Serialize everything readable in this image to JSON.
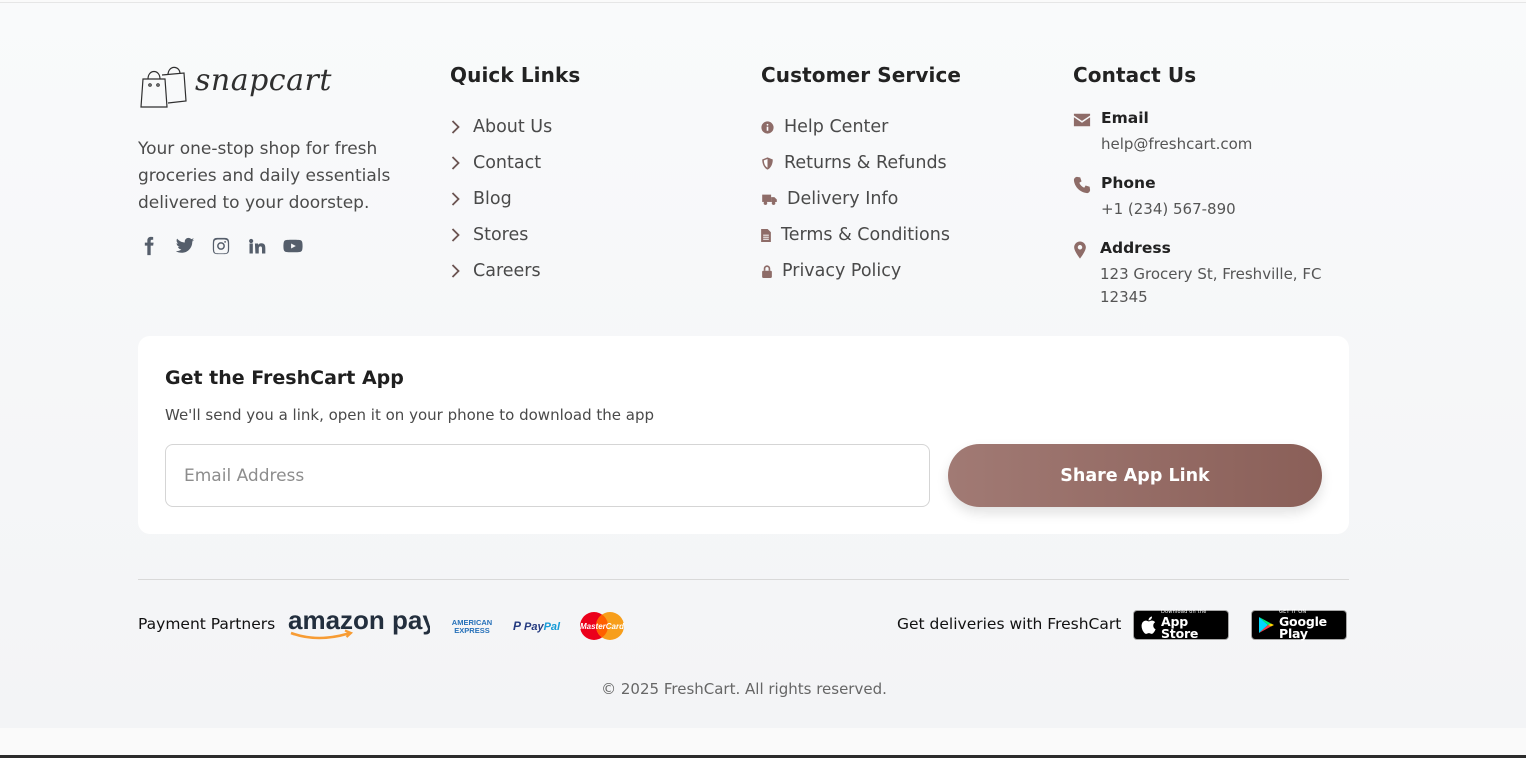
{
  "brand": {
    "logo_text": "snapcart",
    "tagline": "Your one-stop shop for fresh groceries and daily essentials delivered to your doorstep.",
    "socials": [
      "facebook-icon",
      "twitter-icon",
      "instagram-icon",
      "linkedin-icon",
      "youtube-icon"
    ]
  },
  "quick_links": {
    "title": "Quick Links",
    "items": [
      {
        "label": "About Us",
        "icon": "chevron-right-icon"
      },
      {
        "label": "Contact",
        "icon": "chevron-right-icon"
      },
      {
        "label": "Blog",
        "icon": "chevron-right-icon"
      },
      {
        "label": "Stores",
        "icon": "chevron-right-icon"
      },
      {
        "label": "Careers",
        "icon": "chevron-right-icon"
      }
    ]
  },
  "customer_service": {
    "title": "Customer Service",
    "items": [
      {
        "label": "Help Center",
        "icon": "info-circle-icon"
      },
      {
        "label": "Returns & Refunds",
        "icon": "shield-icon"
      },
      {
        "label": "Delivery Info",
        "icon": "truck-icon"
      },
      {
        "label": "Terms & Conditions",
        "icon": "document-icon"
      },
      {
        "label": "Privacy Policy",
        "icon": "lock-icon"
      }
    ]
  },
  "contact": {
    "title": "Contact Us",
    "email": {
      "label": "Email",
      "value": "help@freshcart.com",
      "icon": "envelope-icon"
    },
    "phone": {
      "label": "Phone",
      "value": "+1 (234) 567-890",
      "icon": "phone-icon"
    },
    "address": {
      "label": "Address",
      "value": "123 Grocery St, Freshville, FC 12345",
      "icon": "map-pin-icon"
    }
  },
  "app_card": {
    "title": "Get the FreshCart App",
    "subtitle": "We'll send you a link, open it on your phone to download the app",
    "email_placeholder": "Email Address",
    "button_label": "Share App Link"
  },
  "payments": {
    "label": "Payment Partners",
    "partners": [
      "amazon pay",
      "AMERICAN EXPRESS",
      "PayPal",
      "MasterCard"
    ]
  },
  "delivery": {
    "label": "Get deliveries with FreshCart",
    "app_store": {
      "small": "Download on the",
      "big": "App Store"
    },
    "google_play": {
      "small": "GET IT ON",
      "big": "Google Play"
    }
  },
  "copyright": "© 2025 FreshCart. All rights reserved.",
  "colors": {
    "accent": "#8e6c68",
    "button_gradient_start": "#a17a74",
    "button_gradient_end": "#8a5f58"
  }
}
